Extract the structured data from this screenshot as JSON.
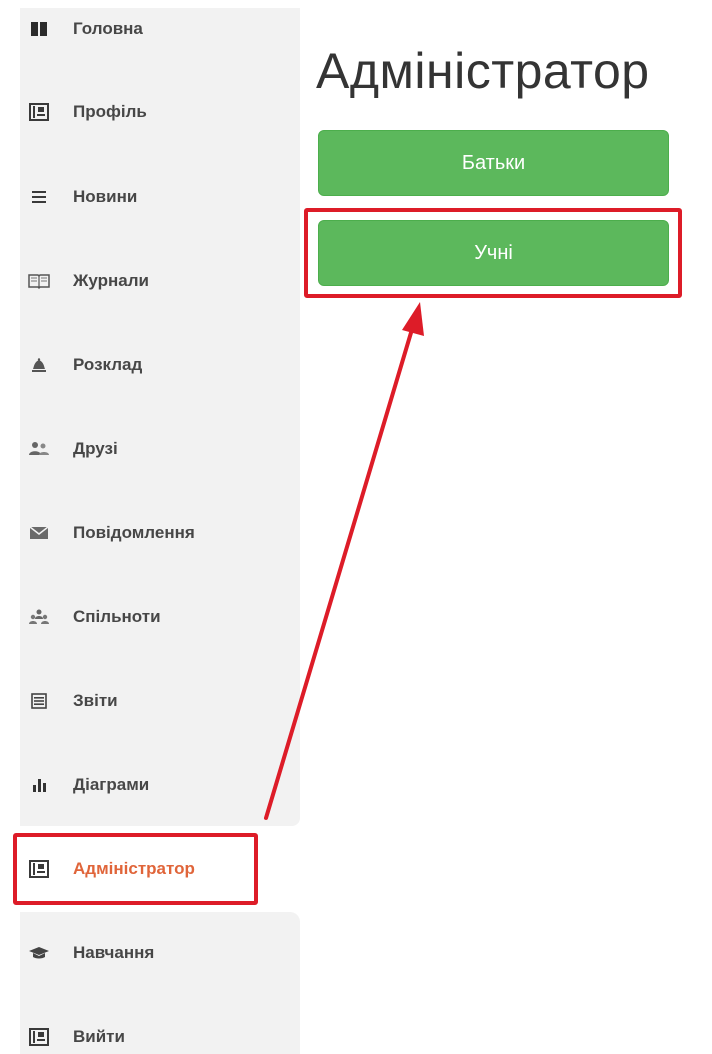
{
  "sidebar": {
    "items": [
      {
        "label": "Головна",
        "icon": "home-icon"
      },
      {
        "label": "Профіль",
        "icon": "profile-card-icon"
      },
      {
        "label": "Новини",
        "icon": "list-icon"
      },
      {
        "label": "Журнали",
        "icon": "book-icon"
      },
      {
        "label": "Розклад",
        "icon": "bell-icon"
      },
      {
        "label": "Друзі",
        "icon": "users-icon"
      },
      {
        "label": "Повідомлення",
        "icon": "envelope-icon"
      },
      {
        "label": "Спільноти",
        "icon": "group-icon"
      },
      {
        "label": "Звіти",
        "icon": "report-icon"
      },
      {
        "label": "Діаграми",
        "icon": "bar-chart-icon"
      },
      {
        "label": "Адміністратор",
        "icon": "admin-card-icon",
        "active": true
      },
      {
        "label": "Навчання",
        "icon": "graduation-cap-icon"
      },
      {
        "label": "Вийти",
        "icon": "logout-card-icon"
      }
    ]
  },
  "main": {
    "title": "Адміністратор",
    "buttons": {
      "parents": "Батьки",
      "students": "Учні"
    }
  },
  "colors": {
    "button_green": "#5cb85c",
    "highlight_red": "#dd1c28",
    "active_orange": "#e0653a",
    "sidebar_bg": "#f2f2f2",
    "text_dark": "#474747"
  }
}
